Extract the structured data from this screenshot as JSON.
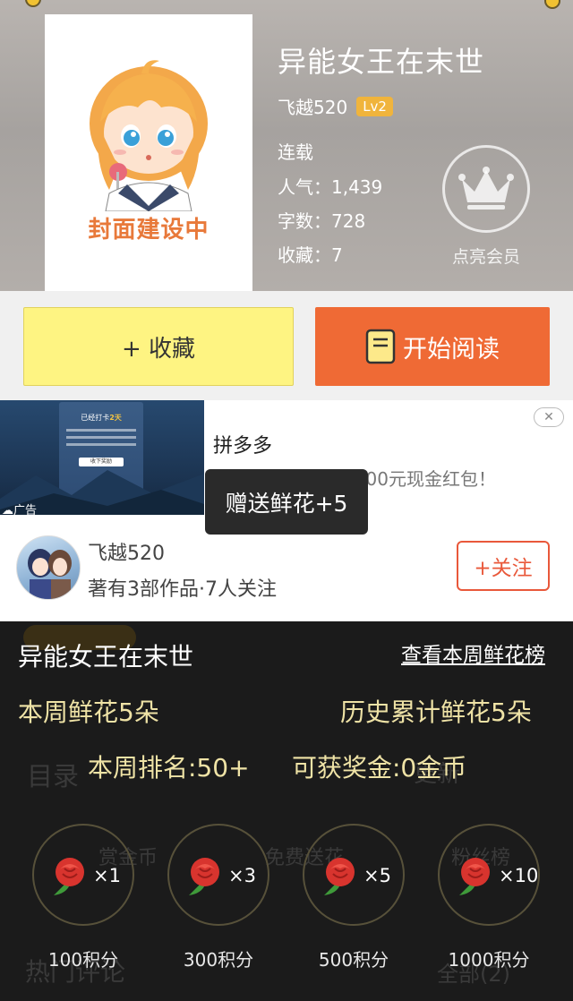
{
  "book": {
    "title": "异能女王在末世",
    "cover_text": "封面建设中",
    "author": "飞越520",
    "level": "Lv2",
    "status": "连载",
    "popularity": "人气：1,439",
    "word_count": "字数：728",
    "favorites": "收藏：7",
    "vip_label": "点亮会员"
  },
  "actions": {
    "favorite_label": "+ 收藏",
    "read_label": "开始阅读"
  },
  "ad": {
    "tag": "广告",
    "brand": "拼多多",
    "description": "APP内签到可领取100元现金红包！",
    "thumb_title": "已经打卡",
    "thumb_days": "2天",
    "thumb_button": "收下奖励"
  },
  "author_card": {
    "name": "飞越520",
    "info": "著有3部作品·7人关注",
    "follow_label": "+关注"
  },
  "underlay": {
    "toc": "目录",
    "update": "更新",
    "bounty": "赏金币",
    "free_gift": "免费送花",
    "fans": "粉丝榜",
    "hot_comments": "热门评论",
    "all_comments": "全部(2)"
  },
  "flower_popup": {
    "title": "异能女王在末世",
    "weekly_rank_link": "查看本周鲜花榜",
    "week_flowers": "本周鲜花5朵",
    "total_flowers": "历史累计鲜花5朵",
    "week_rank": "本周排名:50+",
    "bonus": "可获奖金:0金币",
    "options": [
      {
        "count": "×1",
        "price": "100积分"
      },
      {
        "count": "×3",
        "price": "300积分"
      },
      {
        "count": "×5",
        "price": "500积分"
      },
      {
        "count": "×10",
        "price": "1000积分"
      }
    ]
  },
  "toast": {
    "message": "赠送鲜花+5"
  },
  "colors": {
    "favorite_bg": "#fef482",
    "read_bg": "#ef6a35",
    "follow_accent": "#e9583a",
    "level_badge": "#f0b43c",
    "popup_bg": "#1b1b1b",
    "stat_text": "#efe3a6"
  }
}
